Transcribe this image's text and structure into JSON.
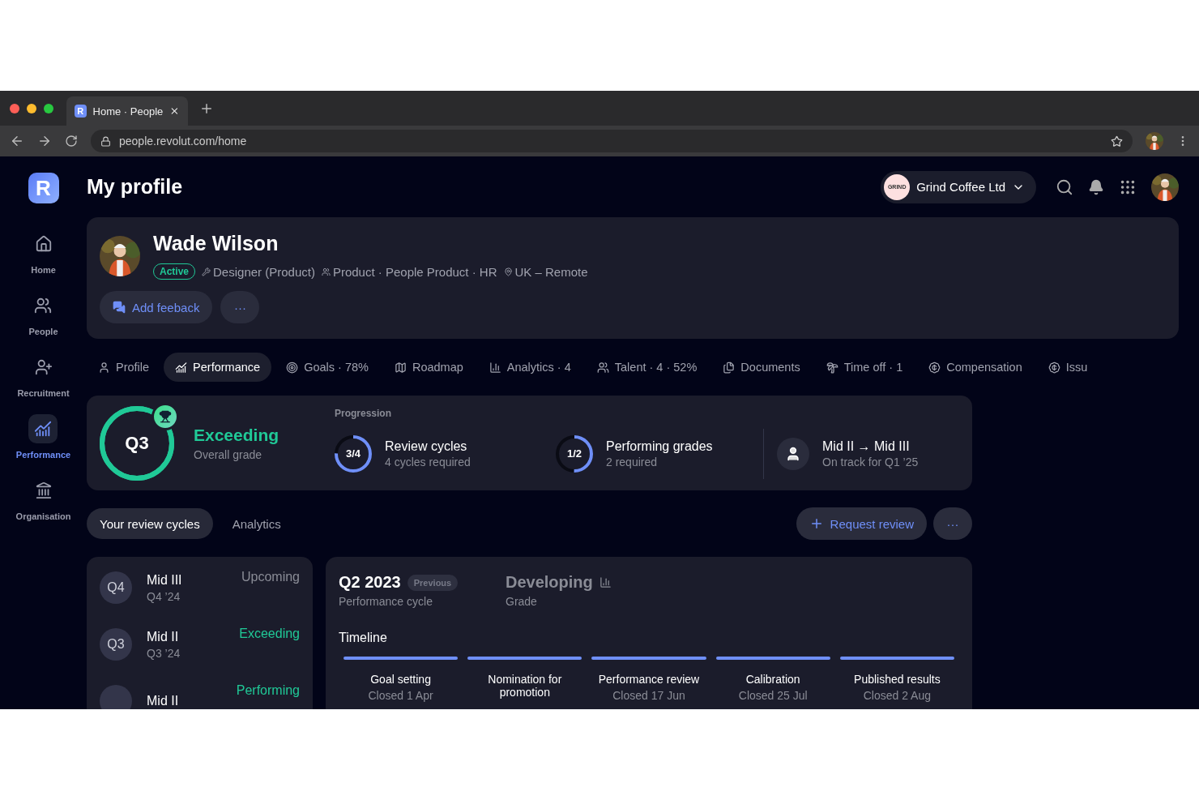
{
  "browser": {
    "tab_title": "Home · People",
    "tab_icon": "R",
    "url": "people.revolut.com/home"
  },
  "sidebar": {
    "logo": "R",
    "items": [
      {
        "label": "Home",
        "selected": false
      },
      {
        "label": "People",
        "selected": false
      },
      {
        "label": "Recruitment",
        "selected": false
      },
      {
        "label": "Performance",
        "selected": true
      },
      {
        "label": "Organisation",
        "selected": false
      }
    ]
  },
  "header": {
    "title": "My profile",
    "company": {
      "logo_text": "GRIND",
      "name": "Grind Coffee Ltd"
    }
  },
  "profile": {
    "name": "Wade Wilson",
    "status": "Active",
    "meta": [
      "Designer (Product)",
      "Product · People Product · HR",
      "UK – Remote"
    ],
    "actions": [
      {
        "kind": "primary",
        "label": "Add feeback"
      },
      {
        "kind": "more",
        "label": "···"
      }
    ]
  },
  "tabs": [
    {
      "label": "Profile",
      "selected": false
    },
    {
      "label": "Performance",
      "selected": true
    },
    {
      "label": "Goals · 78%",
      "selected": false
    },
    {
      "label": "Roadmap",
      "selected": false
    },
    {
      "label": "Analytics · 4",
      "selected": false
    },
    {
      "label": "Talent · 4 · 52%",
      "selected": false
    },
    {
      "label": "Documents",
      "selected": false
    },
    {
      "label": "Time off · 1",
      "selected": false
    },
    {
      "label": "Compensation",
      "selected": false
    },
    {
      "label": "Issu",
      "selected": false
    }
  ],
  "summary": {
    "quarter": "Q3",
    "grade": "Exceeding",
    "grade_label": "Overall grade",
    "progression_label": "Progression",
    "progress": [
      {
        "value": "3/4",
        "title": "Review cycles",
        "subtitle": "4 cycles required",
        "level": 0.75
      },
      {
        "value": "1/2",
        "title": "Performing grades",
        "subtitle": "2 required",
        "level": 0.5
      }
    ],
    "next_level": {
      "title": "Mid II → Mid III",
      "subtitle": "On track for Q1 ’25"
    }
  },
  "subtabs": [
    {
      "label": "Your review cycles",
      "selected": true
    },
    {
      "label": "Analytics",
      "selected": false
    }
  ],
  "toolbar": {
    "request": "Request review",
    "more": "···"
  },
  "cycles": [
    {
      "badge": "Q4",
      "title": "Mid III",
      "date": "Q4 ’24",
      "grade": "Upcoming",
      "color": "#8a8c96"
    },
    {
      "badge": "Q3",
      "title": "Mid II",
      "date": "Q3 ’24",
      "grade": "Exceeding",
      "color": "#20c997"
    },
    {
      "title": "Mid II",
      "grade": "Performing",
      "color": "#20c997"
    }
  ],
  "detail": {
    "title": "Q2 2023",
    "tag": "Previous",
    "subtitle": "Performance cycle",
    "grade": "Developing",
    "grade_label": "Grade",
    "timeline_label": "Timeline",
    "stages": [
      {
        "title": "Goal setting",
        "date": "Closed 1 Apr"
      },
      {
        "title": "Nomination for promotion"
      },
      {
        "title": "Performance review",
        "date": "Closed 17 Jun"
      },
      {
        "title": "Calibration",
        "date": "Closed 25 Jul"
      },
      {
        "title": "Published results",
        "date": "Closed 2 Aug"
      }
    ]
  }
}
